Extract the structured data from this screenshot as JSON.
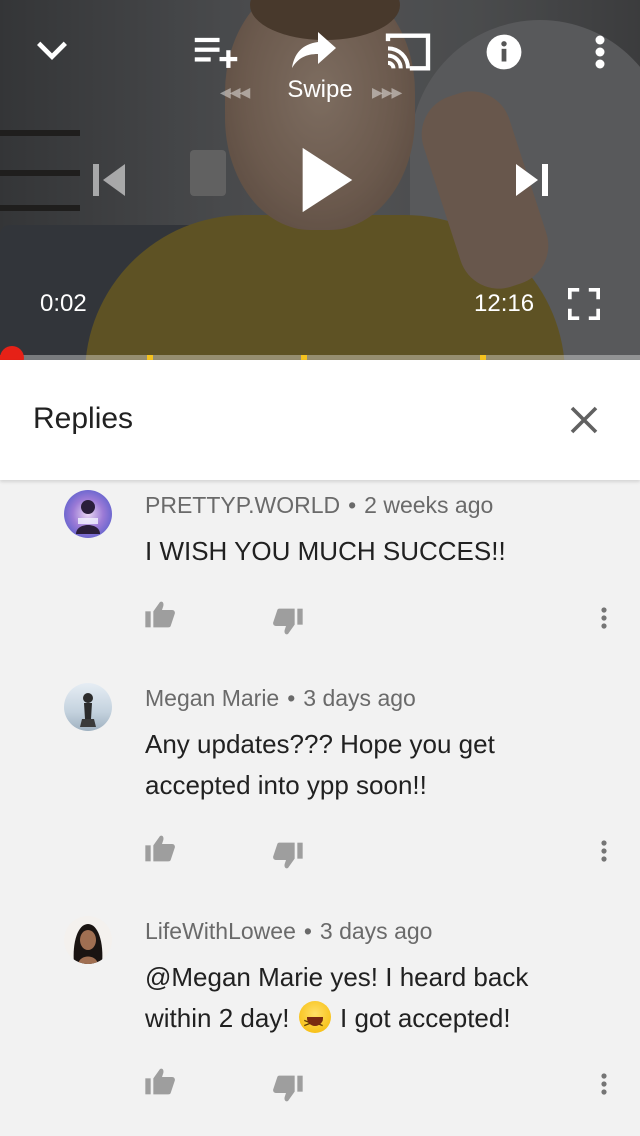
{
  "player": {
    "swipe_label": "Swipe",
    "elapsed": "0:02",
    "duration": "12:16",
    "progress_fraction": 0.005,
    "ad_markers": [
      0.23,
      0.47,
      0.75
    ],
    "icons": [
      "chevron-down-icon",
      "add-to-queue-icon",
      "share-icon",
      "cast-icon",
      "info-icon",
      "more-vert-icon",
      "previous-icon",
      "play-icon",
      "next-icon",
      "fullscreen-icon"
    ],
    "accent_color": "#e62117",
    "marker_color": "#f4c21f"
  },
  "replies_panel": {
    "title": "Replies",
    "close_icon": "close-icon"
  },
  "comments": [
    {
      "author": "PRETTYP.WORLD",
      "age": "2 weeks ago",
      "text": "I WISH YOU MUCH SUCCES!!"
    },
    {
      "author": "Megan Marie",
      "age": "3 days ago",
      "text_line1": "Any updates??? Hope you get",
      "text_line2": "accepted into ypp soon!!"
    },
    {
      "author": "LifeWithLowee",
      "age": "3 days ago",
      "text_line1": "@Megan Marie yes! I heard back",
      "text_line2a": "within  2 day!",
      "text_line2b": "I got accepted!"
    }
  ],
  "actions": {
    "like_icon": "thumb-up-icon",
    "dislike_icon": "thumb-down-icon",
    "more_icon": "more-vert-icon"
  }
}
